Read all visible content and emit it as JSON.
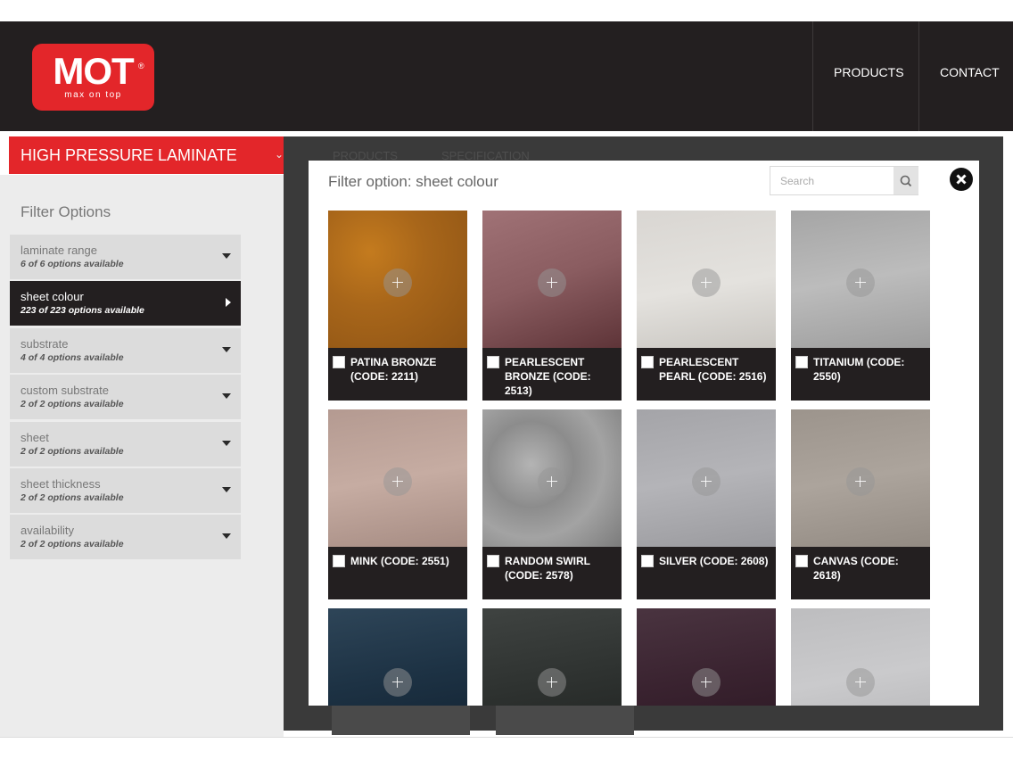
{
  "header": {
    "logo": {
      "word": "MOT",
      "reg": "®",
      "tagline": "max on top"
    },
    "nav": {
      "products": "PRODUCTS",
      "contact": "CONTACT"
    }
  },
  "category": {
    "title": "HIGH PRESSURE LAMINATE"
  },
  "background_tabs": {
    "products": "PRODUCTS",
    "specification": "SPECIFICATION"
  },
  "filters": {
    "heading": "Filter Options",
    "items": [
      {
        "label": "laminate range",
        "sub": "6 of 6 options available"
      },
      {
        "label": "sheet colour",
        "sub": "223 of 223 options available"
      },
      {
        "label": "substrate",
        "sub": "4 of 4 options available"
      },
      {
        "label": "custom substrate",
        "sub": "2 of 2 options available"
      },
      {
        "label": "sheet",
        "sub": "2 of 2 options available"
      },
      {
        "label": "sheet thickness",
        "sub": "2 of 2 options available"
      },
      {
        "label": "availability",
        "sub": "2 of 2 options available"
      }
    ]
  },
  "modal": {
    "title": "Filter option: sheet colour",
    "search_placeholder": "Search",
    "swatches": [
      {
        "label": "PATINA BRONZE (CODE: 2211)"
      },
      {
        "label": "PEARLESCENT BRONZE (CODE: 2513)"
      },
      {
        "label": "PEARLESCENT PEARL (CODE: 2516)"
      },
      {
        "label": "TITANIUM (CODE: 2550)"
      },
      {
        "label": "MINK (CODE: 2551)"
      },
      {
        "label": "RANDOM SWIRL (CODE: 2578)"
      },
      {
        "label": "SILVER (CODE: 2608)"
      },
      {
        "label": "CANVAS (CODE: 2618)"
      },
      {
        "label": ""
      },
      {
        "label": ""
      },
      {
        "label": ""
      },
      {
        "label": ""
      }
    ]
  },
  "colors": {
    "brand_red": "#e3262a",
    "header_dark": "#231f20",
    "panel_grey": "#ececec"
  }
}
